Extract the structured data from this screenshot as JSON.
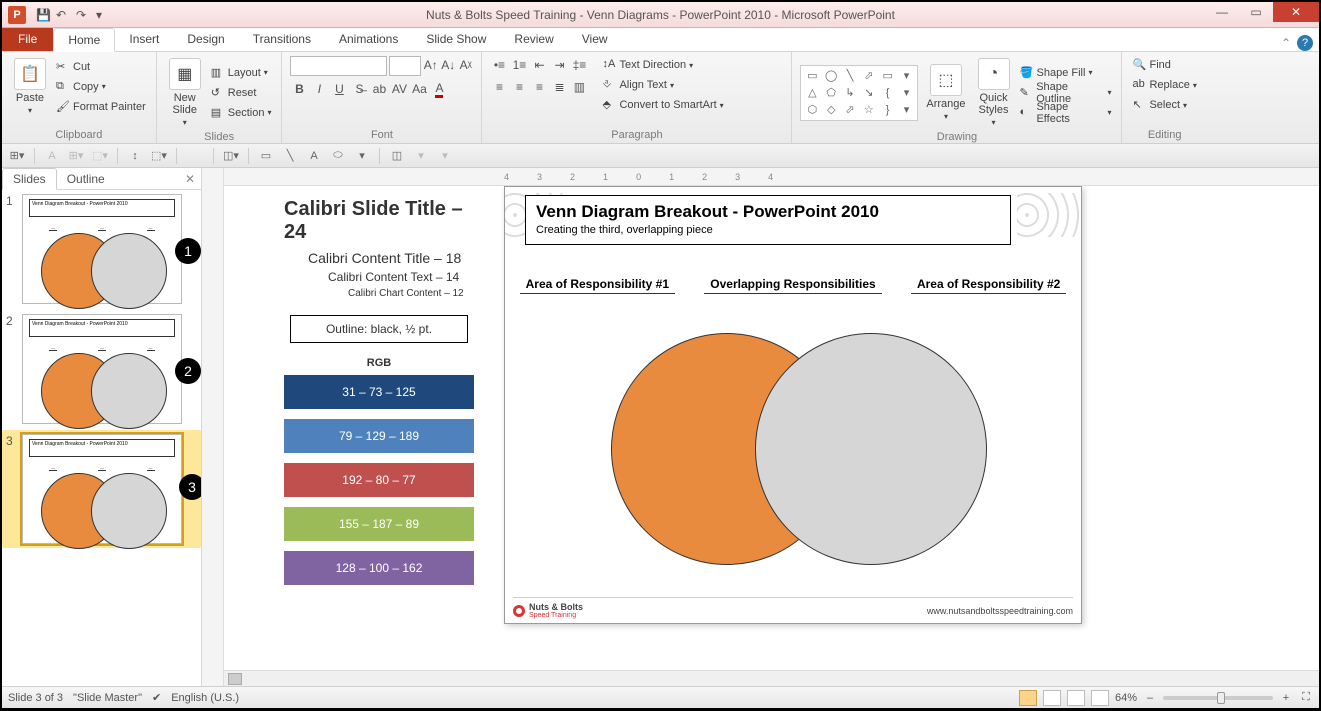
{
  "app_icon_letter": "P",
  "window_title": "Nuts & Bolts Speed Training - Venn Diagrams - PowerPoint 2010  -  Microsoft PowerPoint",
  "tabs": {
    "file": "File",
    "items": [
      "Home",
      "Insert",
      "Design",
      "Transitions",
      "Animations",
      "Slide Show",
      "Review",
      "View"
    ],
    "active": "Home"
  },
  "ribbon": {
    "clipboard": {
      "paste": "Paste",
      "cut": "Cut",
      "copy": "Copy",
      "format_painter": "Format Painter",
      "label": "Clipboard"
    },
    "slides": {
      "new_slide": "New\nSlide",
      "layout": "Layout",
      "reset": "Reset",
      "section": "Section",
      "label": "Slides"
    },
    "font": {
      "label": "Font"
    },
    "paragraph": {
      "text_direction": "Text Direction",
      "align_text": "Align Text",
      "convert_smartart": "Convert to SmartArt",
      "label": "Paragraph"
    },
    "drawing": {
      "arrange": "Arrange",
      "quick_styles": "Quick\nStyles",
      "shape_fill": "Shape Fill",
      "shape_outline": "Shape Outline",
      "shape_effects": "Shape Effects",
      "label": "Drawing"
    },
    "editing": {
      "find": "Find",
      "replace": "Replace",
      "select": "Select",
      "label": "Editing"
    }
  },
  "ruler_marks": [
    "4",
    "3",
    "2",
    "1",
    "0",
    "1",
    "2",
    "3",
    "4"
  ],
  "pane": {
    "slides_tab": "Slides",
    "outline_tab": "Outline"
  },
  "thumbs": [
    {
      "num": "1",
      "badge": "1",
      "title": "Venn Diagram Breakout - PowerPoint 2010"
    },
    {
      "num": "2",
      "badge": "2",
      "title": "Venn Diagram Breakout - PowerPoint 2010"
    },
    {
      "num": "3",
      "badge": "3",
      "title": "Venn Diagram Breakout - PowerPoint 2010"
    }
  ],
  "guide": {
    "title": "Calibri  Slide Title – 24",
    "l18": "Calibri Content Title – 18",
    "l14": "Calibri Content Text – 14",
    "l12": "Calibri  Chart  Content – 12",
    "outline": "Outline: black, ½ pt.",
    "rgb": "RGB",
    "swatches": [
      "31 – 73 – 125",
      "79 – 129 – 189",
      "192 – 80 – 77",
      "155 – 187 – 89",
      "128 – 100 – 162"
    ]
  },
  "slide": {
    "title": "Venn Diagram Breakout - PowerPoint 2010",
    "subtitle": "Creating the third, overlapping piece",
    "labels": [
      "Area of Responsibility #1",
      "Overlapping Responsibilities",
      "Area of Responsibility #2"
    ],
    "footer_brand": "Nuts & Bolts",
    "footer_brand_sub": "Speed Training",
    "footer_url": "www.nutsandboltsspeedtraining.com"
  },
  "status": {
    "slide": "Slide 3 of 3",
    "master": "\"Slide Master\"",
    "lang": "English (U.S.)",
    "zoom": "64%"
  },
  "chart_data": {
    "type": "venn",
    "sets": [
      {
        "name": "Area of Responsibility #1",
        "color": "#e88b3f"
      },
      {
        "name": "Area of Responsibility #2",
        "color": "#d6d6d6"
      }
    ],
    "intersection_label": "Overlapping Responsibilities",
    "title": "Venn Diagram Breakout - PowerPoint 2010",
    "subtitle": "Creating the third, overlapping piece"
  }
}
